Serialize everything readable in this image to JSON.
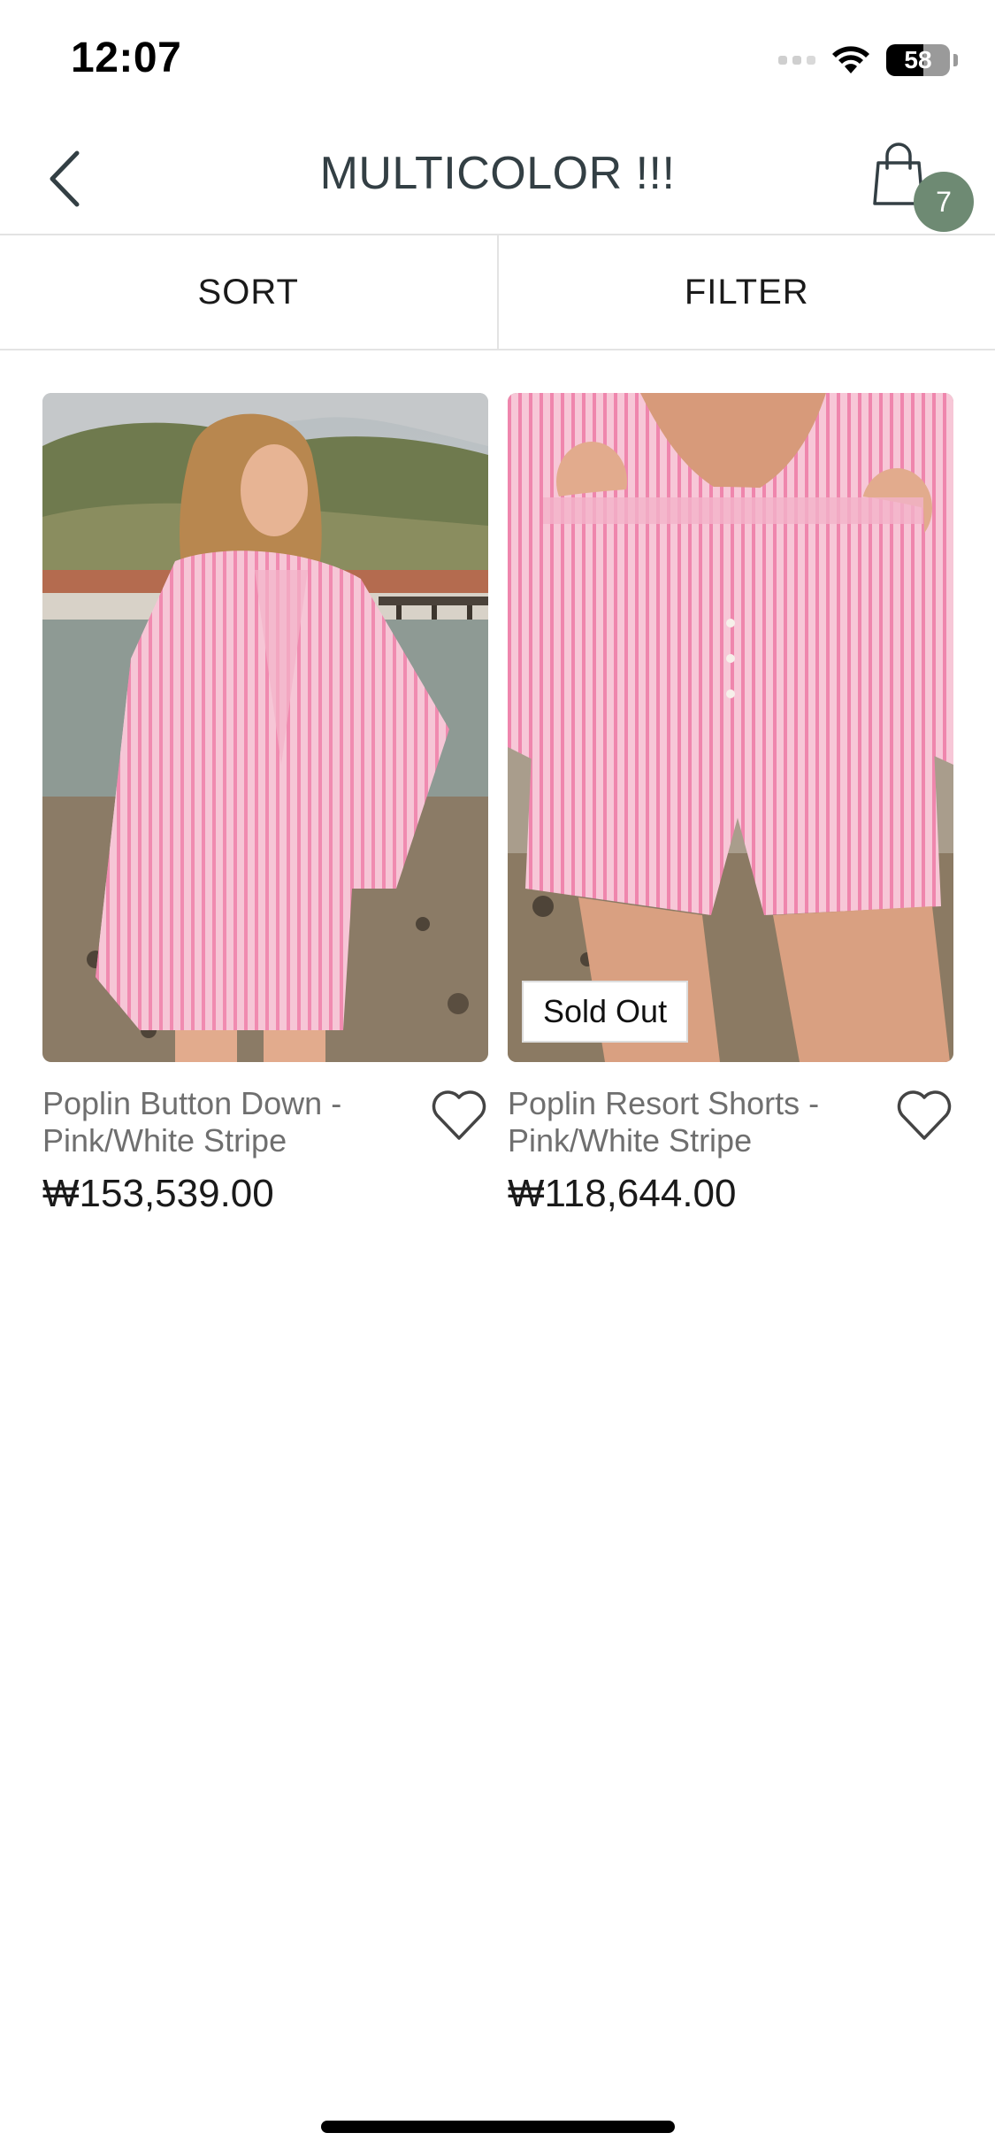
{
  "status_bar": {
    "time": "12:07",
    "battery_level": "58"
  },
  "header": {
    "title": "MULTICOLOR !!!",
    "cart_count": "7"
  },
  "toolbar": {
    "sort_label": "SORT",
    "filter_label": "FILTER"
  },
  "products": [
    {
      "name": "Poplin Button Down - Pink/White Stripe",
      "price": "₩153,539.00",
      "badge": ""
    },
    {
      "name": "Poplin Resort Shorts - Pink/White Stripe",
      "price": "₩118,644.00",
      "badge": "Sold Out"
    }
  ],
  "colors": {
    "accent": "#6e8a73",
    "title": "#333f44",
    "product_pink": "#f2a3bf"
  },
  "icons": {
    "back": "chevron-left-icon",
    "cart": "shopping-bag-icon",
    "wishlist": "heart-outline-icon"
  }
}
